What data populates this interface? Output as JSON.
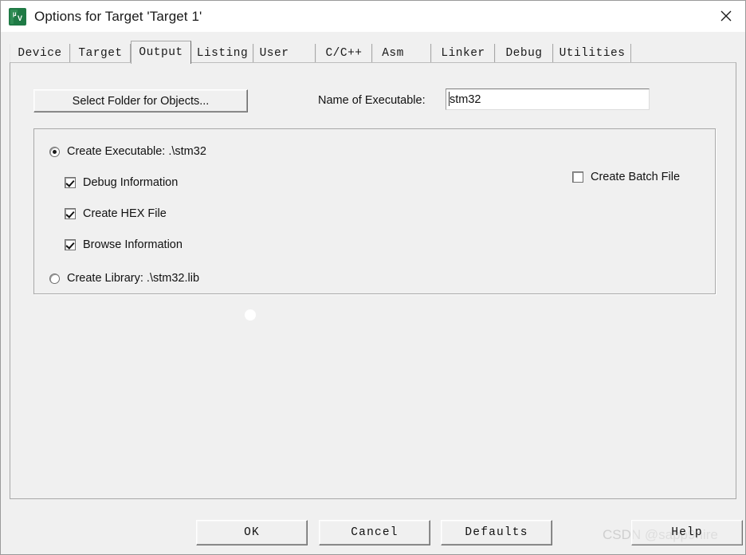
{
  "window": {
    "title": "Options for Target 'Target 1'",
    "app_icon": "uvision-logo-icon",
    "close_icon": "close-icon"
  },
  "tabs": [
    {
      "label": "Device",
      "selected": false
    },
    {
      "label": "Target",
      "selected": false
    },
    {
      "label": "Output",
      "selected": true
    },
    {
      "label": "Listing",
      "selected": false
    },
    {
      "label": "User",
      "selected": false
    },
    {
      "label": "C/C++",
      "selected": false
    },
    {
      "label": "Asm",
      "selected": false
    },
    {
      "label": "Linker",
      "selected": false
    },
    {
      "label": "Debug",
      "selected": false
    },
    {
      "label": "Utilities",
      "selected": false
    }
  ],
  "output_page": {
    "select_folder_button": "Select Folder for Objects...",
    "executable_name_label": "Name of Executable:",
    "executable_name_value": "stm32",
    "executable_name_placeholder": "",
    "create_executable": {
      "label": "Create Executable:  .\\stm32",
      "selected": true
    },
    "create_library": {
      "label": "Create Library:  .\\stm32.lib",
      "selected": false
    },
    "debug_information": {
      "label": "Debug Information",
      "checked": true
    },
    "create_hex_file": {
      "label": "Create HEX File",
      "checked": true
    },
    "browse_information": {
      "label": "Browse Information",
      "checked": true
    },
    "create_batch_file": {
      "label": "Create Batch File",
      "checked": false
    }
  },
  "footer": {
    "ok": "OK",
    "cancel": "Cancel",
    "defaults": "Defaults",
    "help": "Help"
  },
  "watermark": "CSDN @sapp9hire",
  "colors": {
    "dialog_face": "#f0f0f0",
    "titlebar": "#ffffff",
    "border": "#a8a8a8",
    "text": "#111111",
    "logo_green": "#1f7a45",
    "watermark": "#cfcfcf"
  }
}
